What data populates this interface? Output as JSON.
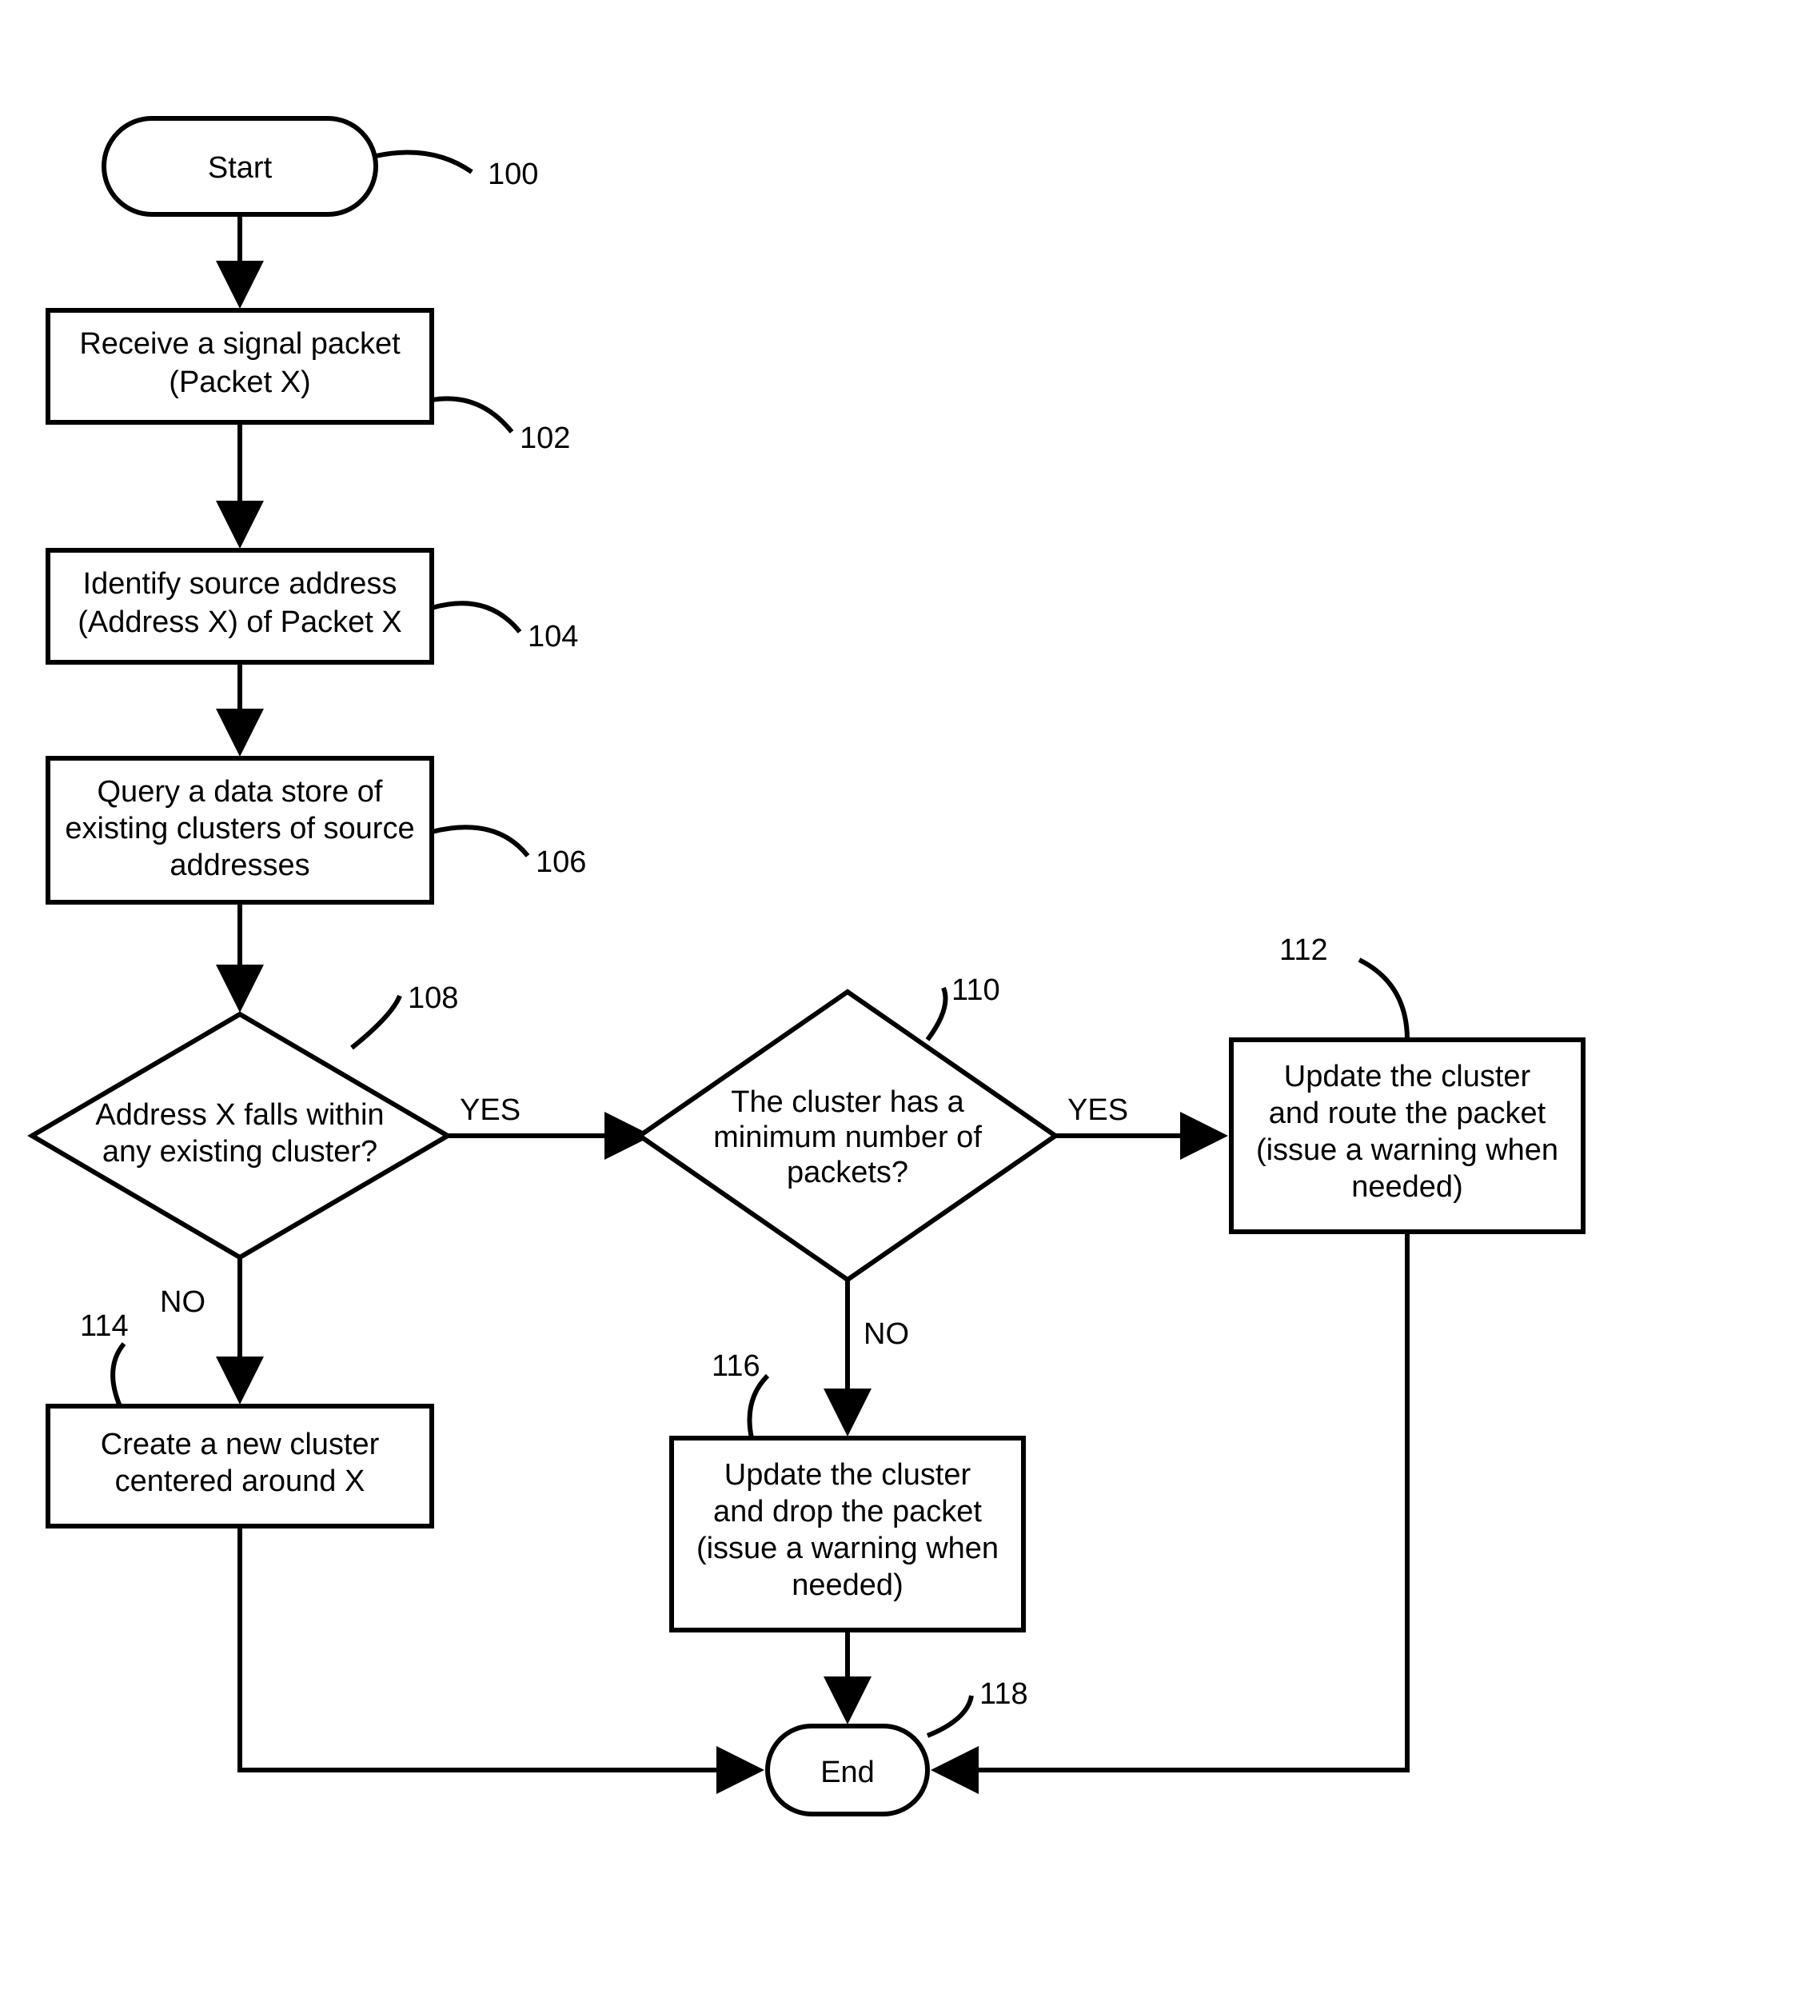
{
  "nodes": {
    "start": {
      "label": "Start",
      "ref": "100"
    },
    "receive": {
      "line1": "Receive a signal packet",
      "line2": "(Packet X)",
      "ref": "102"
    },
    "identify": {
      "line1": "Identify source address",
      "line2": "(Address X) of Packet X",
      "ref": "104"
    },
    "query": {
      "line1": "Query a data store of",
      "line2": "existing clusters of source",
      "line3": "addresses",
      "ref": "106"
    },
    "dec1": {
      "line1": "Address X falls within",
      "line2": "any existing cluster?",
      "ref": "108"
    },
    "dec2": {
      "line1": "The cluster has a",
      "line2": "minimum number of",
      "line3": "packets?",
      "ref": "110"
    },
    "updateRoute": {
      "line1": "Update the cluster",
      "line2": "and route the packet",
      "line3": "(issue a warning when",
      "line4": "needed)",
      "ref": "112"
    },
    "createNew": {
      "line1": "Create a new cluster",
      "line2": "centered around X",
      "ref": "114"
    },
    "updateDrop": {
      "line1": "Update the cluster",
      "line2": "and drop the packet",
      "line3": "(issue a warning when",
      "line4": "needed)",
      "ref": "116"
    },
    "end": {
      "label": "End",
      "ref": "118"
    }
  },
  "labels": {
    "yes": "YES",
    "no": "NO"
  }
}
